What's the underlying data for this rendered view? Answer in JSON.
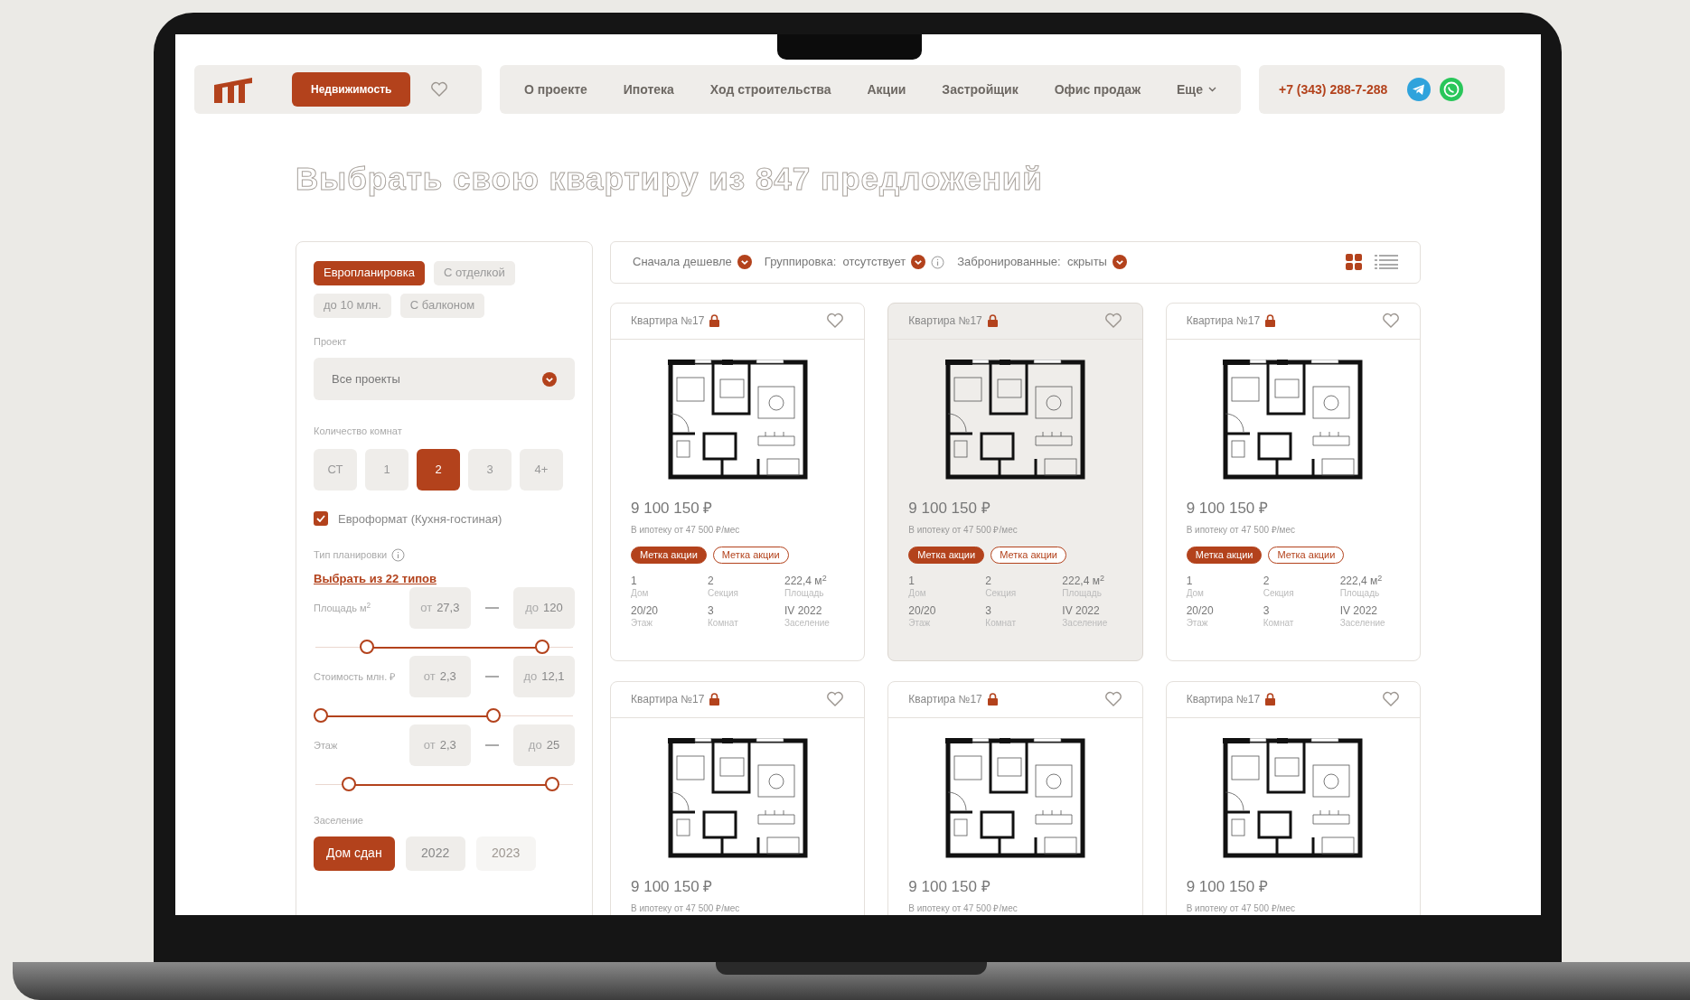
{
  "header": {
    "primary_button": "Недвижимость",
    "nav": [
      "О проекте",
      "Ипотека",
      "Ход строительства",
      "Акции",
      "Застройщик",
      "Офис продаж"
    ],
    "more": "Еще",
    "phone": "+7 (343) 288-7-288"
  },
  "title": "Выбрать свою квартиру из 847 предложений",
  "filters": {
    "chips": [
      {
        "label": "Европланировка",
        "selected": true
      },
      {
        "label": "С отделкой",
        "selected": false
      },
      {
        "label": "до 10 млн.",
        "selected": false
      },
      {
        "label": "С балконом",
        "selected": false
      }
    ],
    "project": {
      "label": "Проект",
      "value": "Все проекты"
    },
    "rooms": {
      "label": "Количество комнат",
      "options": [
        {
          "label": "СТ",
          "selected": false
        },
        {
          "label": "1",
          "selected": false
        },
        {
          "label": "2",
          "selected": true
        },
        {
          "label": "3",
          "selected": false
        },
        {
          "label": "4+",
          "selected": false
        }
      ]
    },
    "euro": {
      "label": "Евроформат (Кухня-гостиная)",
      "checked": true
    },
    "layout_type": {
      "label": "Тип планировки",
      "link": "Выбрать из 22 типов"
    },
    "ranges": [
      {
        "label": "Площадь м$^{2}$",
        "from": {
          "prefix": "от",
          "value": "27,3"
        },
        "to": {
          "prefix": "до",
          "value": "120"
        },
        "thumbs": [
          {
            "level": 0.2
          },
          {
            "level": 0.88
          }
        ]
      },
      {
        "label": "Стоимость млн. ₽",
        "from": {
          "prefix": "от",
          "value": "2,3"
        },
        "to": {
          "prefix": "до",
          "value": "12,1"
        },
        "thumbs": [
          {
            "level": 0.02
          },
          {
            "level": 0.69
          }
        ]
      },
      {
        "label": "Этаж",
        "from": {
          "prefix": "от",
          "value": "2,3"
        },
        "to": {
          "prefix": "до",
          "value": "25"
        },
        "thumbs": [
          {
            "level": 0.13
          },
          {
            "level": 0.92
          }
        ]
      }
    ],
    "settlement": {
      "label": "Заселение",
      "options": [
        {
          "label": "Дом сдан",
          "selected": true,
          "disabled": false
        },
        {
          "label": "2022",
          "selected": false,
          "disabled": false
        },
        {
          "label": "2023",
          "selected": false,
          "disabled": true
        }
      ]
    }
  },
  "toolbar": {
    "sorts": [
      {
        "label": "Сначала дешевле",
        "info": false
      },
      {
        "label": "Группировка:  отсутствует",
        "info": true
      },
      {
        "label": "Забронированные:  скрыты",
        "info": false
      }
    ],
    "views": [
      {
        "kind": "grid",
        "selected": true
      },
      {
        "kind": "list",
        "selected": false
      }
    ]
  },
  "cards": [
    {
      "title": "Квартира №17",
      "highlighted": false,
      "price": "9 100 150 ₽",
      "mortgage": "В ипотеку от 47 500 ₽/мес",
      "tags": [
        {
          "label": "Метка акции",
          "kind": "filled"
        },
        {
          "label": "Метка акции",
          "kind": "outline"
        }
      ],
      "specs": [
        {
          "value": "1",
          "label": "Дом"
        },
        {
          "value": "2",
          "label": "Секция"
        },
        {
          "value": "222,4 м$^{2}$",
          "label": "Площадь"
        },
        {
          "value": "20/20",
          "label": "Этаж"
        },
        {
          "value": "3",
          "label": "Комнат"
        },
        {
          "value": "IV 2022",
          "label": "Заселение"
        }
      ]
    },
    {
      "title": "Квартира №17",
      "highlighted": true,
      "price": "9 100 150 ₽",
      "mortgage": "В ипотеку от 47 500 ₽/мес",
      "tags": [
        {
          "label": "Метка акции",
          "kind": "filled"
        },
        {
          "label": "Метка акции",
          "kind": "outline"
        }
      ],
      "specs": [
        {
          "value": "1",
          "label": "Дом"
        },
        {
          "value": "2",
          "label": "Секция"
        },
        {
          "value": "222,4 м$^{2}$",
          "label": "Площадь"
        },
        {
          "value": "20/20",
          "label": "Этаж"
        },
        {
          "value": "3",
          "label": "Комнат"
        },
        {
          "value": "IV 2022",
          "label": "Заселение"
        }
      ]
    },
    {
      "title": "Квартира №17",
      "highlighted": false,
      "price": "9 100 150 ₽",
      "mortgage": "В ипотеку от 47 500 ₽/мес",
      "tags": [
        {
          "label": "Метка акции",
          "kind": "filled"
        },
        {
          "label": "Метка акции",
          "kind": "outline"
        }
      ],
      "specs": [
        {
          "value": "1",
          "label": "Дом"
        },
        {
          "value": "2",
          "label": "Секция"
        },
        {
          "value": "222,4 м$^{2}$",
          "label": "Площадь"
        },
        {
          "value": "20/20",
          "label": "Этаж"
        },
        {
          "value": "3",
          "label": "Комнат"
        },
        {
          "value": "IV 2022",
          "label": "Заселение"
        }
      ]
    },
    {
      "title": "Квартира №17",
      "highlighted": false,
      "price": "9 100 150 ₽",
      "mortgage": "В ипотеку от 47 500 ₽/мес"
    },
    {
      "title": "Квартира №17",
      "highlighted": false,
      "price": "9 100 150 ₽",
      "mortgage": "В ипотеку от 47 500 ₽/мес"
    },
    {
      "title": "Квартира №17",
      "highlighted": false,
      "price": "9 100 150 ₽",
      "mortgage": "В ипотеку от 47 500 ₽/мес"
    }
  ]
}
